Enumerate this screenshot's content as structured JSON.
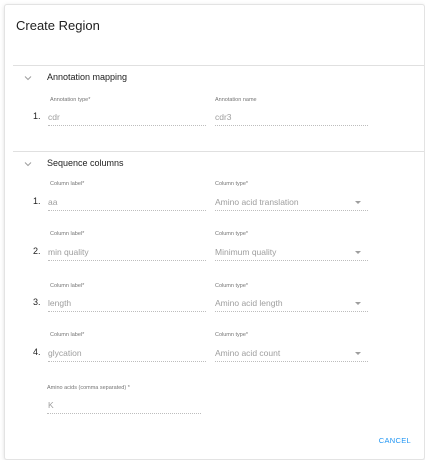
{
  "dialog": {
    "title": "Create Region",
    "cancel_label": "CANCEL"
  },
  "annotation_mapping": {
    "title": "Annotation mapping",
    "type_label": "Annotation type",
    "name_label": "Annotation name",
    "row_number": "1.",
    "type_value": "cdr",
    "name_value": "cdr3"
  },
  "sequence_columns": {
    "title": "Sequence columns",
    "rows": [
      {
        "number": "1.",
        "label_caption": "Column label",
        "label_value": "aa",
        "type_caption": "Column type",
        "type_value": "Amino acid translation"
      },
      {
        "number": "2.",
        "label_caption": "Column label",
        "label_value": "min quality",
        "type_caption": "Column type",
        "type_value": "Minimum quality"
      },
      {
        "number": "3.",
        "label_caption": "Column label",
        "label_value": "length",
        "type_caption": "Column type",
        "type_value": "Amino acid length"
      },
      {
        "number": "4.",
        "label_caption": "Column label",
        "label_value": "glycation",
        "type_caption": "Column type",
        "type_value": "Amino acid count"
      }
    ],
    "amino_acids_label": "Amino acids (comma separated)",
    "amino_acids_value": "K"
  },
  "required_marker": "*"
}
